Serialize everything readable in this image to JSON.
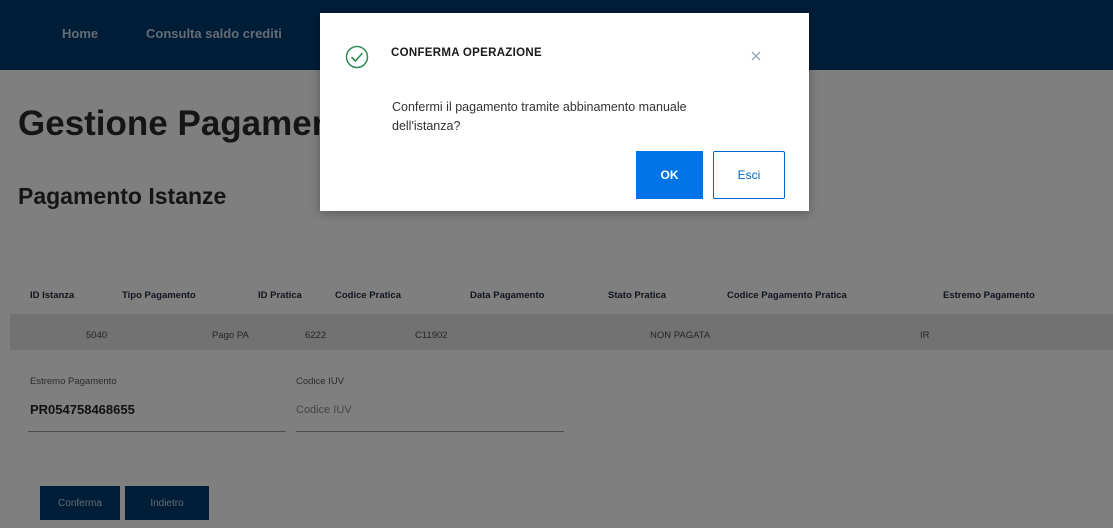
{
  "navbar": {
    "home_label": "Home",
    "consulta_label": "Consulta saldo crediti"
  },
  "page": {
    "title": "Gestione Pagamenti",
    "section_title": "Pagamento Istanze"
  },
  "table": {
    "headers": [
      "ID Istanza",
      "Tipo Pagamento",
      "ID Pratica",
      "Codice Pratica",
      "Data Pagamento",
      "Stato Pratica",
      "Codice Pagamento Pratica",
      "Estremo Pagamento"
    ],
    "row": [
      "5040",
      "Pago PA",
      "6222",
      "C11902",
      "",
      "NON PAGATA",
      "",
      "IR"
    ]
  },
  "form": {
    "estremo_label": "Estremo Pagamento",
    "estremo_value": "PR054758468655",
    "codice_iuv_label": "Codice IUV",
    "codice_iuv_placeholder": "Codice IUV"
  },
  "buttons": {
    "conferma": "Conferma",
    "indietro": "Indietro"
  },
  "modal": {
    "title": "CONFERMA OPERAZIONE",
    "message": "Confermi il pagamento tramite abbinamento manuale dell'istanza?",
    "ok_label": "OK",
    "esci_label": "Esci"
  },
  "colors": {
    "navbar": "#003a70",
    "ok_button": "#0073e6",
    "success_icon": "#2e8b57"
  },
  "icons": {
    "modal_status": "check-circle-icon",
    "modal_close": "close-icon"
  }
}
